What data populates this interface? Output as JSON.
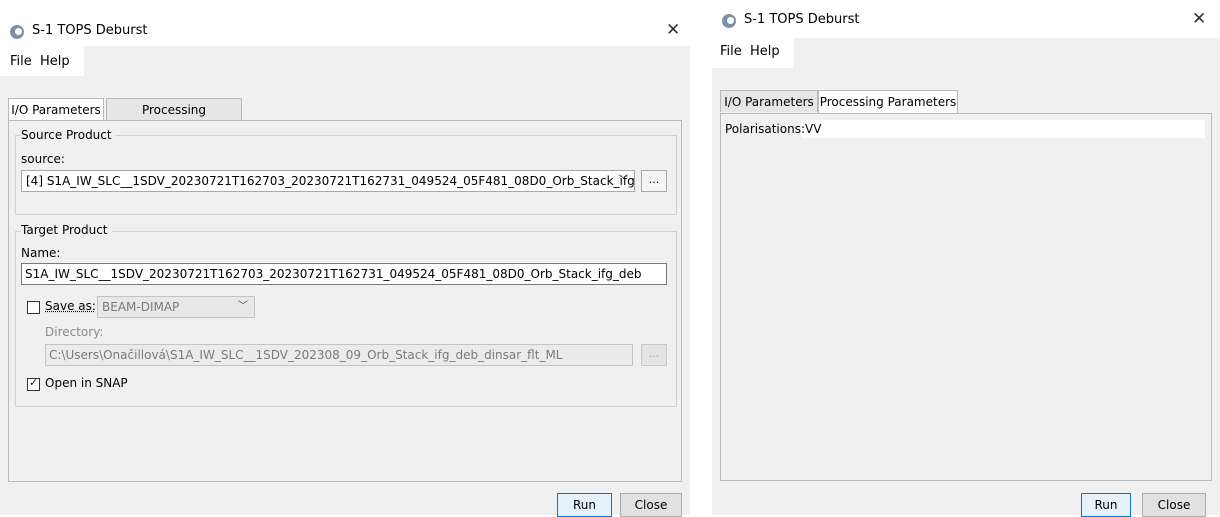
{
  "left_window": {
    "title": "S-1 TOPS Deburst",
    "menu": [
      "File",
      "Help"
    ],
    "tabs": [
      "I/O Parameters",
      "Processing Parameters"
    ],
    "active_tab": "I/O Parameters",
    "source_product": {
      "group_title": "Source Product",
      "source_label": "source:",
      "source_value": "[4] S1A_IW_SLC__1SDV_20230721T162703_20230721T162731_049524_05F481_08D0_Orb_Stack_ifg",
      "browse_label": "..."
    },
    "target_product": {
      "group_title": "Target Product",
      "name_label": "Name:",
      "name_value": "S1A_IW_SLC__1SDV_20230721T162703_20230721T162731_049524_05F481_08D0_Orb_Stack_ifg_deb",
      "save_as_label": "Save as:",
      "save_as_checked": false,
      "format_value": "BEAM-DIMAP",
      "directory_label": "Directory:",
      "directory_value": "C:\\Users\\Onačillová\\S1A_IW_SLC__1SDV_202308_09_Orb_Stack_ifg_deb_dinsar_flt_ML",
      "browse_label": "...",
      "open_in_snap_label": "Open in SNAP",
      "open_in_snap_checked": true
    },
    "buttons": {
      "run": "Run",
      "close": "Close"
    }
  },
  "right_window": {
    "title": "S-1 TOPS Deburst",
    "menu": [
      "File",
      "Help"
    ],
    "tabs": [
      "I/O Parameters",
      "Processing Parameters"
    ],
    "active_tab": "Processing Parameters",
    "polarisations_label": "Polarisations:",
    "polarisations_value": "VV",
    "buttons": {
      "run": "Run",
      "close": "Close"
    }
  },
  "icons": {
    "app": "snap-app-icon",
    "close": "close-icon",
    "dropdown": "chevron-down-icon"
  }
}
